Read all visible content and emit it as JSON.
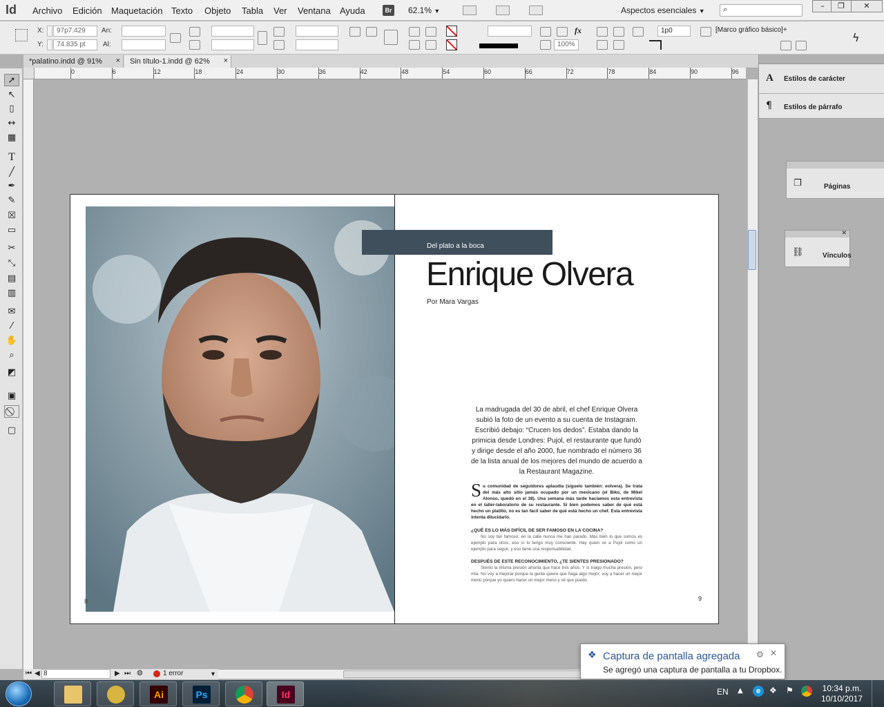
{
  "app": {
    "logo": "Id",
    "window_controls": [
      "–",
      "❐",
      "✕"
    ]
  },
  "menu": [
    "Archivo",
    "Edición",
    "Maquetación",
    "Texto",
    "Objeto",
    "Tabla",
    "Ver",
    "Ventana",
    "Ayuda"
  ],
  "bridge_label": "Br",
  "zoom_level": "62.1%",
  "workspace": "Aspectos esenciales",
  "control_panel": {
    "x_label": "X:",
    "x_value": "97p7.429",
    "y_label": "Y:",
    "y_value": "74.835 pt",
    "w_label": "An:",
    "h_label": "Al:",
    "stroke_weight": "1p0",
    "opacity": "100%",
    "object_style": "[Marco gráfico básico]+"
  },
  "tabs": [
    {
      "label": "*palatino.indd @ 91%",
      "close": "×"
    },
    {
      "label": "Sin título-1.indd @ 62%",
      "close": "×"
    }
  ],
  "ruler_h": [
    "0",
    "6",
    "12",
    "18",
    "24",
    "30",
    "36",
    "42",
    "48",
    "54",
    "60",
    "66",
    "72",
    "78",
    "84",
    "90",
    "96"
  ],
  "document": {
    "kicker": "Del plato a la boca",
    "headline": "Enrique Olvera",
    "byline": "Por Mara Vargas",
    "lede": "La madrugada del 30 de abril, el chef Enrique Olvera subió la foto de un evento a su cuenta de Instagram. Escribió debajo: “Crucen los dedos”. Estaba dando la primicia desde Londres: Pujol, el restaurante que fundó y dirige desde el año 2000, fue nombrado el número 36 de la lista anual de los mejores del mundo de acuerdo a la Restaurant Magazine.",
    "dropcap": "S",
    "intro": "u comunidad de seguidores aplaudía (síguelo también: eolvera). Se trata del más alto sitio jamás ocupado por un mexicano (el Biko, de Mikel Alonso, quedó en el 38). Una semana más tarde hacíamos esta entrevista en el taller-laboratorio de su restaurante. Si bien podemos saber de qué está hecho un platillo, no es tan fácil saber de qué está hecho un chef. Esta entrevista intenta dilucidarlo.",
    "q1": "¿QUÉ ES LO MÁS DIFÍCIL DE SER FAMOSO EN LA COCINA?",
    "a1": "No soy tan famoso; en la calle nunca me han parado. Más bien lo que somos es ejemplo para otros, eso sí lo tengo muy consciente. Hay quien ve a Pujol como un ejemplo para seguir, y eso tiene una responsabilidad.",
    "q2": "DESPUÉS DE ESTE RECONOCIMIENTO, ¿TE SIENTES PRESIONADO?",
    "a2": "Siento la misma presión ahorita que hace tres años. Y sí traigo mucha presión, pero mía. No voy a mejorar porque la gente quiere que haga algo mejor; voy a hacer un mejor menú porque yo quiero hacer un mejor menú y sé que puedo.",
    "folio_right": "9",
    "folio_left": "8"
  },
  "status": {
    "page": "8",
    "errors": "1 error"
  },
  "panels": {
    "char_styles": "Estilos de carácter",
    "para_styles": "Estilos de párrafo",
    "pages": "Páginas",
    "links": "Vínculos"
  },
  "notification": {
    "title": "Captura de pantalla agregada",
    "body": "Se agregó una captura de pantalla a tu Dropbox."
  },
  "taskbar": {
    "lang": "EN",
    "time": "10:34 p.m.",
    "date": "10/10/2017",
    "apps": [
      {
        "name": "explorer",
        "label": ""
      },
      {
        "name": "tools",
        "label": ""
      },
      {
        "name": "illustrator",
        "label": "Ai",
        "color": "#ff9a00",
        "bg": "#330000"
      },
      {
        "name": "photoshop",
        "label": "Ps",
        "color": "#31a8ff",
        "bg": "#001e36"
      },
      {
        "name": "chrome",
        "label": ""
      },
      {
        "name": "indesign",
        "label": "Id",
        "color": "#ff3366",
        "bg": "#49021f"
      }
    ]
  }
}
